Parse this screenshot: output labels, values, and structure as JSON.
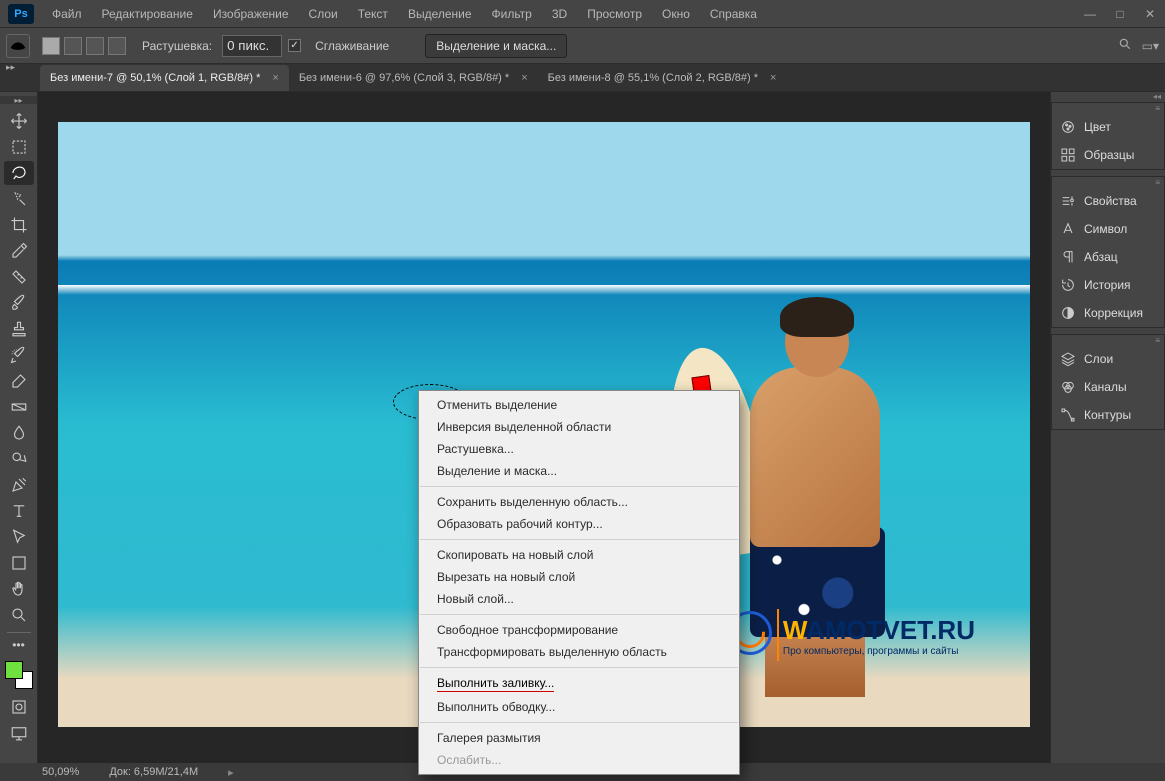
{
  "menubar": [
    "Файл",
    "Редактирование",
    "Изображение",
    "Слои",
    "Текст",
    "Выделение",
    "Фильтр",
    "3D",
    "Просмотр",
    "Окно",
    "Справка"
  ],
  "options": {
    "feather_label": "Растушевка:",
    "feather_value": "0 пикс.",
    "antialias": "Сглаживание",
    "select_mask": "Выделение и маска..."
  },
  "tabs": [
    {
      "label": "Без имени-7 @ 50,1% (Слой 1, RGB/8#) *",
      "active": true
    },
    {
      "label": "Без имени-6 @ 97,6% (Слой 3, RGB/8#) *",
      "active": false
    },
    {
      "label": "Без имени-8 @ 55,1% (Слой 2, RGB/8#) *",
      "active": false
    }
  ],
  "panels": {
    "g1": [
      "Цвет",
      "Образцы"
    ],
    "g2": [
      "Свойства",
      "Символ",
      "Абзац",
      "История",
      "Коррекция"
    ],
    "g3": [
      "Слои",
      "Каналы",
      "Контуры"
    ]
  },
  "context_menu": [
    {
      "t": "Отменить выделение"
    },
    {
      "t": "Инверсия выделенной области"
    },
    {
      "t": "Растушевка..."
    },
    {
      "t": "Выделение и маска..."
    },
    {
      "sep": true
    },
    {
      "t": "Сохранить выделенную область..."
    },
    {
      "t": "Образовать рабочий контур..."
    },
    {
      "sep": true
    },
    {
      "t": "Скопировать на новый слой"
    },
    {
      "t": "Вырезать на новый слой"
    },
    {
      "t": "Новый слой..."
    },
    {
      "sep": true
    },
    {
      "t": "Свободное трансформирование"
    },
    {
      "t": "Трансформировать выделенную область"
    },
    {
      "sep": true
    },
    {
      "t": "Выполнить заливку...",
      "hl": true
    },
    {
      "t": "Выполнить обводку..."
    },
    {
      "sep": true
    },
    {
      "t": "Галерея размытия"
    },
    {
      "t": "Ослабить...",
      "disabled": true
    }
  ],
  "status": {
    "zoom": "50,09%",
    "doc": "Док: 6,59M/21,4M"
  },
  "watermark": {
    "pre": "W",
    "mid": "AM",
    "post": "OTVET.RU",
    "sub": "Про компьютеры, программы и сайты"
  },
  "colors": {
    "fg": "#70e040",
    "bg": "#ffffff"
  }
}
